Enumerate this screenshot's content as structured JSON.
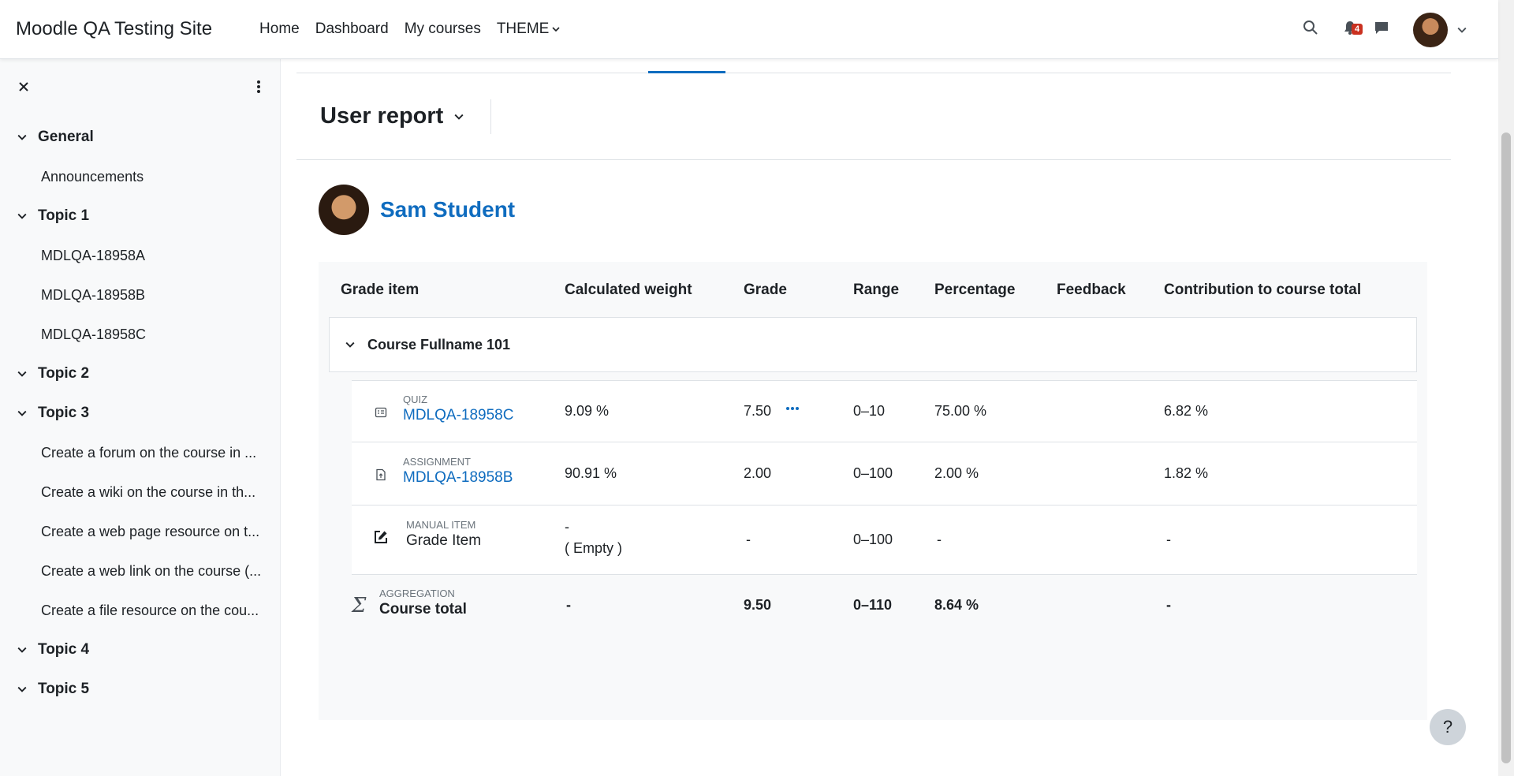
{
  "site": {
    "name": "Moodle QA Testing Site"
  },
  "nav": {
    "home": "Home",
    "dashboard": "Dashboard",
    "my_courses": "My courses",
    "theme": "THEME"
  },
  "notifications": {
    "count": "4"
  },
  "drawer": {
    "sections": [
      {
        "title": "General",
        "items": [
          "Announcements"
        ]
      },
      {
        "title": "Topic 1",
        "items": [
          "MDLQA-18958A",
          "MDLQA-18958B",
          "MDLQA-18958C"
        ]
      },
      {
        "title": "Topic 2",
        "items": []
      },
      {
        "title": "Topic 3",
        "items": [
          "Create a forum on the course in ...",
          "Create a wiki on the course in th...",
          "Create a web page resource on t...",
          "Create a web link on the course (...",
          "Create a file resource on the cou..."
        ]
      },
      {
        "title": "Topic 4",
        "items": []
      },
      {
        "title": "Topic 5",
        "items": []
      }
    ]
  },
  "report": {
    "title": "User report"
  },
  "user": {
    "name": "Sam Student"
  },
  "table": {
    "headers": {
      "item": "Grade item",
      "weight": "Calculated weight",
      "grade": "Grade",
      "range": "Range",
      "percentage": "Percentage",
      "feedback": "Feedback",
      "contribution": "Contribution to course total"
    },
    "category": "Course Fullname 101",
    "rows": [
      {
        "type": "QUIZ",
        "name": "MDLQA-18958C",
        "weight": "9.09 %",
        "grade": "7.50",
        "range": "0–10",
        "percentage": "75.00 %",
        "contribution": "6.82 %"
      },
      {
        "type": "ASSIGNMENT",
        "name": "MDLQA-18958B",
        "weight": "90.91 %",
        "grade": "2.00",
        "range": "0–100",
        "percentage": "2.00 %",
        "contribution": "1.82 %"
      },
      {
        "type": "MANUAL ITEM",
        "name": "Grade Item",
        "weight": "-",
        "weight_note": "( Empty )",
        "grade": "-",
        "range": "0–100",
        "percentage": "-",
        "contribution": "-"
      }
    ],
    "total": {
      "type": "AGGREGATION",
      "name": "Course total",
      "weight": "-",
      "grade": "9.50",
      "range": "0–110",
      "percentage": "8.64 %",
      "contribution": "-"
    }
  },
  "help": {
    "label": "?"
  }
}
